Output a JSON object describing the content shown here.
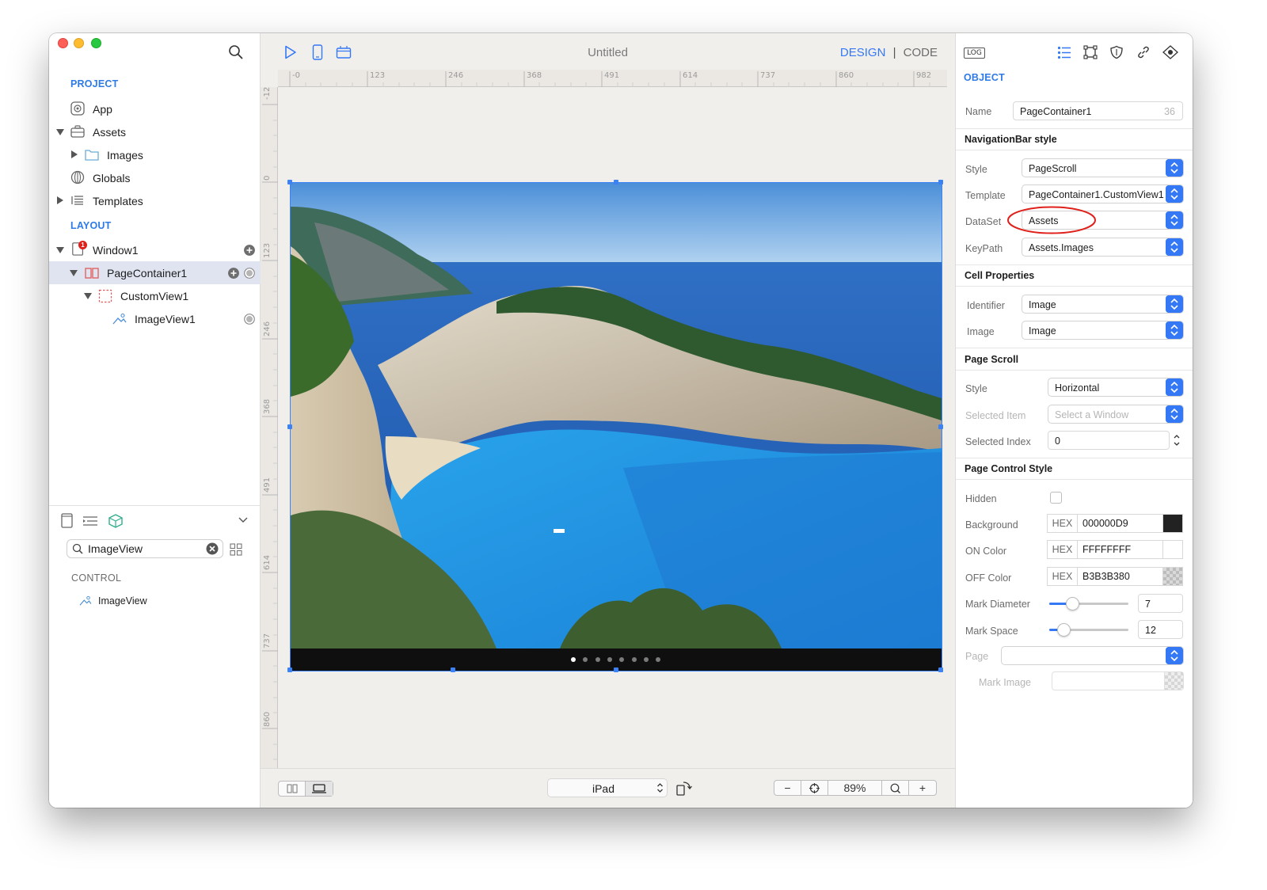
{
  "app": {
    "document_title": "Untitled"
  },
  "sidebar": {
    "project_title": "PROJECT",
    "project_items": [
      {
        "label": "App"
      },
      {
        "label": "Assets"
      },
      {
        "label": "Images"
      },
      {
        "label": "Globals"
      },
      {
        "label": "Templates"
      }
    ],
    "layout_title": "LAYOUT",
    "layout_items": [
      {
        "label": "Window1",
        "badge": "1"
      },
      {
        "label": "PageContainer1"
      },
      {
        "label": "CustomView1"
      },
      {
        "label": "ImageView1"
      }
    ],
    "library": {
      "search_value": "ImageView",
      "section": "CONTROL",
      "items": [
        {
          "label": "ImageView"
        }
      ]
    }
  },
  "toolbar": {
    "design_label": "DESIGN",
    "separator": "|",
    "code_label": "CODE"
  },
  "rulers": {
    "horizontal": [
      "-0",
      "123",
      "246",
      "368",
      "491",
      "614",
      "737",
      "860",
      "982"
    ],
    "vertical": [
      "-12",
      "0",
      "123",
      "246",
      "368",
      "491",
      "614",
      "737",
      "860"
    ]
  },
  "canvas": {
    "image_description": "Navagio beach cove with cliffs and turquoise sea",
    "page_count": 8,
    "current_page": 0
  },
  "bottom_bar": {
    "device": "iPad",
    "zoom": "89%",
    "zoom_out": "−",
    "zoom_in": "+"
  },
  "inspector": {
    "log_label": "LOG",
    "section": "OBJECT",
    "name_label": "Name",
    "name_value": "PageContainer1",
    "name_count": "36",
    "navbar_header": "NavigationBar style",
    "style_label": "Style",
    "style_value": "PageScroll",
    "template_label": "Template",
    "template_value": "PageContainer1.CustomView1",
    "dataset_label": "DataSet",
    "dataset_value": "Assets",
    "keypath_label": "KeyPath",
    "keypath_value": "Assets.Images",
    "cell_header": "Cell Properties",
    "identifier_label": "Identifier",
    "identifier_value": "Image",
    "image_label": "Image",
    "image_value": "Image",
    "pagescroll_header": "Page Scroll",
    "scroll_style_label": "Style",
    "scroll_style_value": "Horizontal",
    "selected_item_label": "Selected Item",
    "selected_item_placeholder": "Select a Window",
    "selected_index_label": "Selected Index",
    "selected_index_value": "0",
    "pagecontrol_header": "Page Control Style",
    "hidden_label": "Hidden",
    "background_label": "Background",
    "background_hex": "000000D9",
    "on_color_label": "ON Color",
    "on_color_hex": "FFFFFFFF",
    "off_color_label": "OFF Color",
    "off_color_hex": "B3B3B380",
    "hex_prefix": "HEX",
    "mark_diameter_label": "Mark Diameter",
    "mark_diameter_value": "7",
    "mark_diameter_fraction": 0.25,
    "mark_space_label": "Mark Space",
    "mark_space_value": "12",
    "mark_space_fraction": 0.12,
    "page_label": "Page",
    "mark_image_label": "Mark Image"
  },
  "colors": {
    "accent": "#3478f6",
    "highlight_circle": "#e0201a",
    "selection": "#dfe4f0"
  }
}
